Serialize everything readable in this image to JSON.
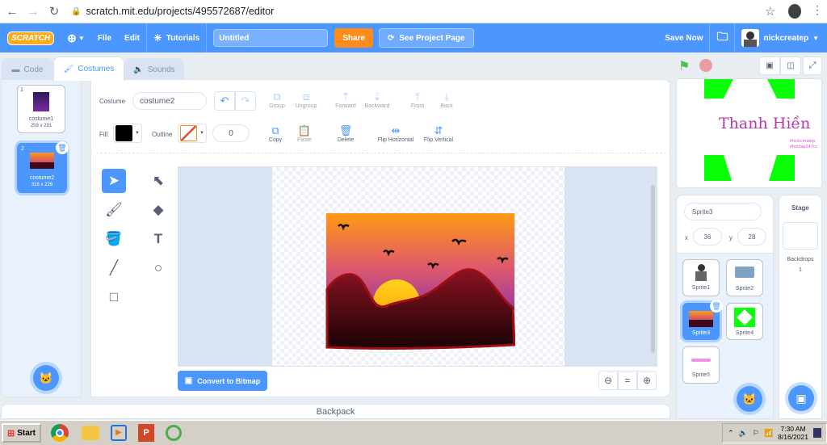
{
  "browser": {
    "url": "scratch.mit.edu/projects/495572687/editor",
    "icons": [
      "back-icon",
      "forward-icon",
      "reload-icon",
      "lock-icon",
      "star-icon",
      "account-icon",
      "more-icon"
    ]
  },
  "menubar": {
    "logo_text": "SCRATCH",
    "file": "File",
    "edit": "Edit",
    "tutorials": "Tutorials",
    "project_title": "Untitled",
    "share": "Share",
    "see_project_page": "See Project Page",
    "save_now": "Save Now",
    "username": "nickcreatep",
    "accent": "#4c97ff",
    "share_color": "#ff8c1a"
  },
  "tabs": {
    "code": "Code",
    "costumes": "Costumes",
    "sounds": "Sounds"
  },
  "costumes": [
    {
      "index": "1",
      "name": "costume1",
      "size": "259 x 291"
    },
    {
      "index": "2",
      "name": "costume2",
      "size": "316 x 226"
    }
  ],
  "paint": {
    "costume_label": "Costume",
    "costume_name": "costume2",
    "fill_label": "Fill",
    "outline_label": "Outline",
    "outline_width": "0",
    "buttons": {
      "group": "Group",
      "ungroup": "Ungroup",
      "forward": "Forward",
      "backward": "Backward",
      "front": "Front",
      "back": "Back",
      "copy": "Copy",
      "paste": "Paste",
      "delete": "Delete",
      "flip_horizontal": "Flip Horizontal",
      "flip_vertical": "Flip Vertical"
    },
    "convert": "Convert to Bitmap",
    "zoom_reset": "="
  },
  "stage": {
    "text": "Thanh Hiền",
    "tag1": "#nickcreatep",
    "tag2": "#hoidap247cc"
  },
  "sprite_info": {
    "name": "Sprite3",
    "x_label": "x",
    "x": "36",
    "y_label": "y",
    "y": "28"
  },
  "sprites": [
    "Sprite1",
    "Sprite2",
    "Sprite3",
    "Sprite4",
    "Sprite5"
  ],
  "stage_panel": {
    "title": "Stage",
    "backdrops_label": "Backdrops",
    "backdrops_count": "1"
  },
  "backpack": "Backpack",
  "taskbar": {
    "start": "Start",
    "time": "7:30 AM",
    "date": "8/16/2021"
  }
}
